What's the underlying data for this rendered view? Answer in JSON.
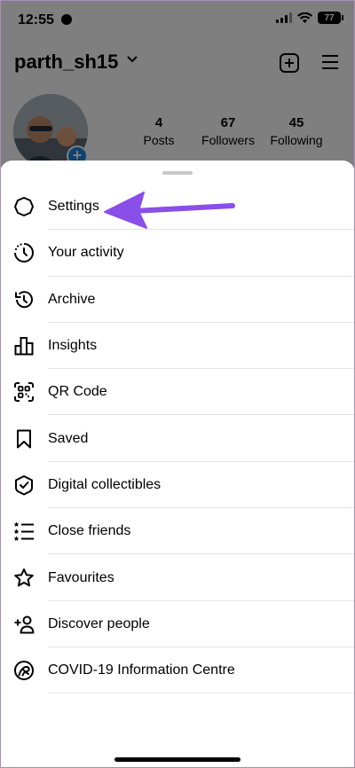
{
  "status_bar": {
    "time": "12:55",
    "battery": "77"
  },
  "profile": {
    "username": "parth_sh15",
    "stats": [
      {
        "value": "4",
        "label": "Posts"
      },
      {
        "value": "67",
        "label": "Followers"
      },
      {
        "value": "45",
        "label": "Following"
      }
    ]
  },
  "menu": {
    "items": [
      {
        "label": "Settings",
        "icon": "settings-icon"
      },
      {
        "label": "Your activity",
        "icon": "activity-icon"
      },
      {
        "label": "Archive",
        "icon": "archive-icon"
      },
      {
        "label": "Insights",
        "icon": "insights-icon"
      },
      {
        "label": "QR Code",
        "icon": "qr-code-icon"
      },
      {
        "label": "Saved",
        "icon": "bookmark-icon"
      },
      {
        "label": "Digital collectibles",
        "icon": "collectibles-icon"
      },
      {
        "label": "Close friends",
        "icon": "close-friends-icon"
      },
      {
        "label": "Favourites",
        "icon": "star-icon"
      },
      {
        "label": "Discover people",
        "icon": "add-person-icon"
      },
      {
        "label": "COVID-19 Information Centre",
        "icon": "covid-info-icon"
      }
    ]
  },
  "colors": {
    "arrow": "#8a4fe8",
    "accent_blue": "#1a84e0",
    "overlay": "rgba(0,0,0,0.5)"
  }
}
